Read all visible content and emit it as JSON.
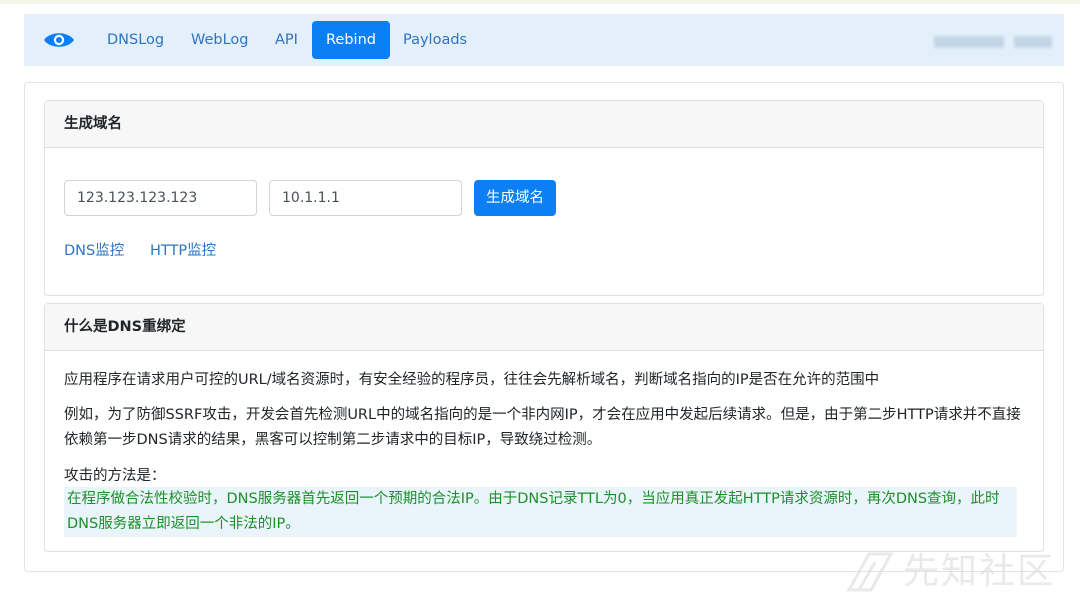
{
  "nav": {
    "items": [
      {
        "label": "DNSLog",
        "active": false
      },
      {
        "label": "WebLog",
        "active": false
      },
      {
        "label": "API",
        "active": false
      },
      {
        "label": "Rebind",
        "active": true
      },
      {
        "label": "Payloads",
        "active": false
      }
    ],
    "logo_icon": "eye-icon"
  },
  "generate": {
    "title": "生成域名",
    "ip1_value": "123.123.123.123",
    "ip2_value": "10.1.1.1",
    "button_label": "生成域名",
    "dns_monitor": "DNS监控",
    "http_monitor": "HTTP监控"
  },
  "info": {
    "title": "什么是DNS重绑定",
    "p1": "应用程序在请求用户可控的URL/域名资源时，有安全经验的程序员，往往会先解析域名，判断域名指向的IP是否在允许的范围中",
    "p2": "例如，为了防御SSRF攻击，开发会首先检测URL中的域名指向的是一个非内网IP，才会在应用中发起后续请求。但是，由于第二步HTTP请求并不直接依赖第一步DNS请求的结果，黑客可以控制第二步请求中的目标IP，导致绕过检测。",
    "p3": "攻击的方法是：",
    "highlight": "在程序做合法性校验时，DNS服务器首先返回一个预期的合法IP。由于DNS记录TTL为0，当应用真正发起HTTP请求资源时，再次DNS查询，此时DNS服务器立即返回一个非法的IP。"
  },
  "watermark": "先知社区",
  "colors": {
    "accent": "#0d7ff5",
    "navbar_bg": "#e3f0fc",
    "link": "#2f74c0",
    "highlight_text": "#1e8f2a"
  }
}
